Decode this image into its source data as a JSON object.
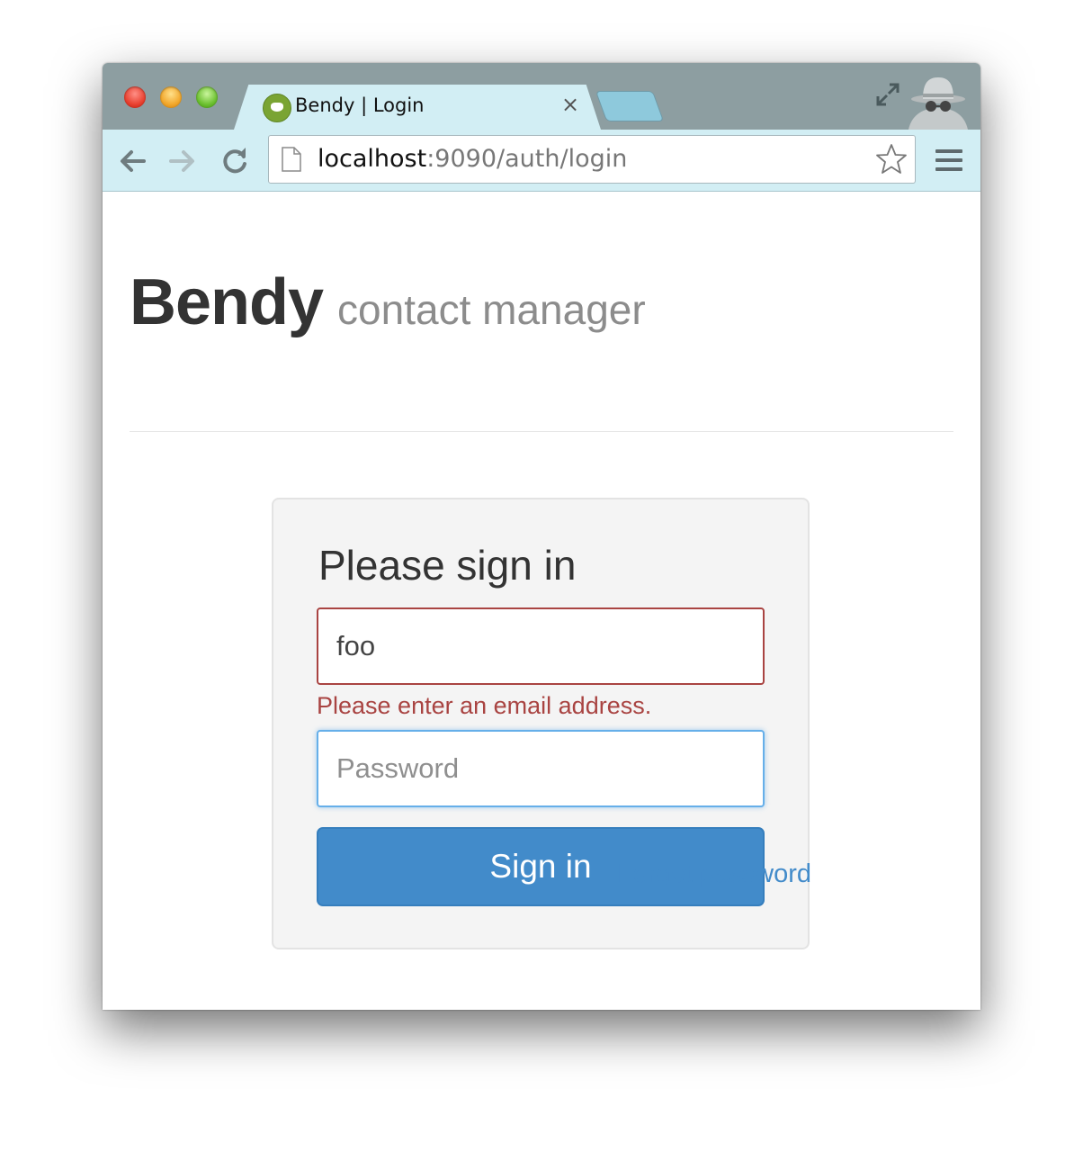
{
  "browser": {
    "tab": {
      "title": "Bendy | Login",
      "close_glyph": "×"
    },
    "omnibox": {
      "url_host": "localhost",
      "url_rest": ":9090/auth/login"
    },
    "icons": {
      "back": "back-arrow-icon",
      "forward": "forward-arrow-icon",
      "reload": "reload-icon",
      "page": "page-icon",
      "star": "star-icon",
      "menu": "hamburger-menu-icon",
      "fullscreen": "fullscreen-icon",
      "incognito": "incognito-icon"
    }
  },
  "page": {
    "brand": "Bendy",
    "tagline": "contact manager",
    "form": {
      "heading": "Please sign in",
      "email_value": "foo",
      "email_error": "Please enter an email address.",
      "password_placeholder": "Password",
      "submit_label": "Sign in"
    },
    "forgot_link": "Forgot password"
  },
  "colors": {
    "primary": "#428bca",
    "error": "#a94442",
    "focus": "#66afe9"
  }
}
